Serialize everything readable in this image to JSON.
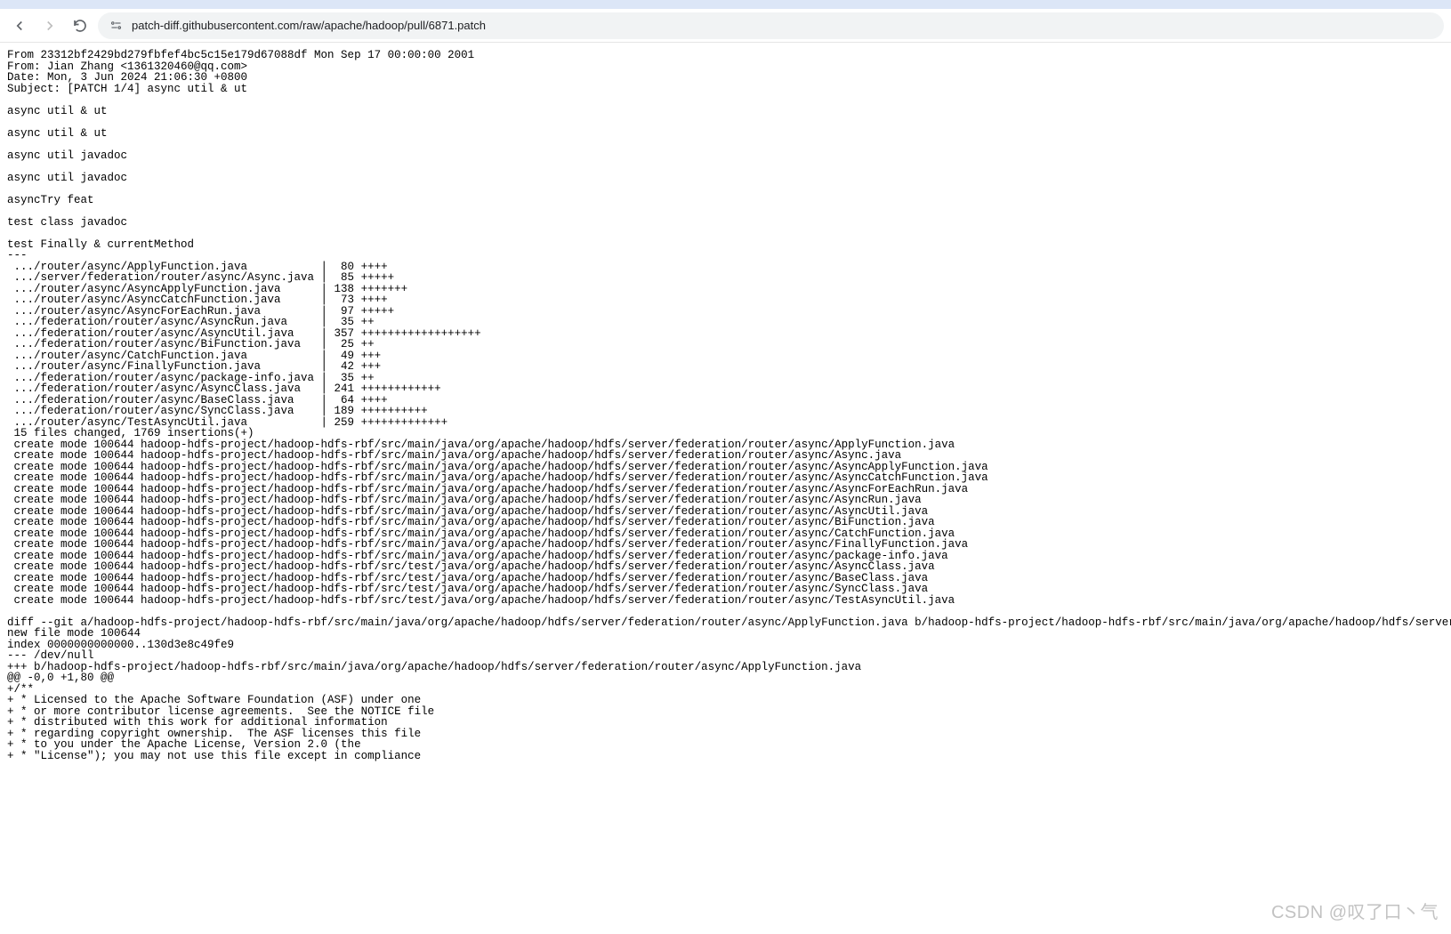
{
  "toolbar": {
    "url": "patch-diff.githubusercontent.com/raw/apache/hadoop/pull/6871.patch"
  },
  "patch": {
    "headers": [
      "From 23312bf2429bd279fbfef4bc5c15e179d67088df Mon Sep 17 00:00:00 2001",
      "From: Jian Zhang <1361320460@qq.com>",
      "Date: Mon, 3 Jun 2024 21:06:30 +0800",
      "Subject: [PATCH 1/4] async util & ut"
    ],
    "body_blocks": [
      "async util & ut",
      "async util & ut",
      "async util javadoc",
      "async util javadoc",
      "asyncTry feat",
      "test class javadoc",
      "test Finally & currentMethod"
    ],
    "sep": "---",
    "diffstat": [
      " .../router/async/ApplyFunction.java           |  80 ++++",
      " .../server/federation/router/async/Async.java |  85 +++++",
      " .../router/async/AsyncApplyFunction.java      | 138 +++++++",
      " .../router/async/AsyncCatchFunction.java      |  73 ++++",
      " .../router/async/AsyncForEachRun.java         |  97 +++++",
      " .../federation/router/async/AsyncRun.java     |  35 ++",
      " .../federation/router/async/AsyncUtil.java    | 357 ++++++++++++++++++",
      " .../federation/router/async/BiFunction.java   |  25 ++",
      " .../router/async/CatchFunction.java           |  49 +++",
      " .../router/async/FinallyFunction.java         |  42 +++",
      " .../federation/router/async/package-info.java |  35 ++",
      " .../federation/router/async/AsyncClass.java   | 241 ++++++++++++",
      " .../federation/router/async/BaseClass.java    |  64 ++++",
      " .../federation/router/async/SyncClass.java    | 189 ++++++++++",
      " .../router/async/TestAsyncUtil.java           | 259 +++++++++++++",
      " 15 files changed, 1769 insertions(+)"
    ],
    "created": [
      " create mode 100644 hadoop-hdfs-project/hadoop-hdfs-rbf/src/main/java/org/apache/hadoop/hdfs/server/federation/router/async/ApplyFunction.java",
      " create mode 100644 hadoop-hdfs-project/hadoop-hdfs-rbf/src/main/java/org/apache/hadoop/hdfs/server/federation/router/async/Async.java",
      " create mode 100644 hadoop-hdfs-project/hadoop-hdfs-rbf/src/main/java/org/apache/hadoop/hdfs/server/federation/router/async/AsyncApplyFunction.java",
      " create mode 100644 hadoop-hdfs-project/hadoop-hdfs-rbf/src/main/java/org/apache/hadoop/hdfs/server/federation/router/async/AsyncCatchFunction.java",
      " create mode 100644 hadoop-hdfs-project/hadoop-hdfs-rbf/src/main/java/org/apache/hadoop/hdfs/server/federation/router/async/AsyncForEachRun.java",
      " create mode 100644 hadoop-hdfs-project/hadoop-hdfs-rbf/src/main/java/org/apache/hadoop/hdfs/server/federation/router/async/AsyncRun.java",
      " create mode 100644 hadoop-hdfs-project/hadoop-hdfs-rbf/src/main/java/org/apache/hadoop/hdfs/server/federation/router/async/AsyncUtil.java",
      " create mode 100644 hadoop-hdfs-project/hadoop-hdfs-rbf/src/main/java/org/apache/hadoop/hdfs/server/federation/router/async/BiFunction.java",
      " create mode 100644 hadoop-hdfs-project/hadoop-hdfs-rbf/src/main/java/org/apache/hadoop/hdfs/server/federation/router/async/CatchFunction.java",
      " create mode 100644 hadoop-hdfs-project/hadoop-hdfs-rbf/src/main/java/org/apache/hadoop/hdfs/server/federation/router/async/FinallyFunction.java",
      " create mode 100644 hadoop-hdfs-project/hadoop-hdfs-rbf/src/main/java/org/apache/hadoop/hdfs/server/federation/router/async/package-info.java",
      " create mode 100644 hadoop-hdfs-project/hadoop-hdfs-rbf/src/test/java/org/apache/hadoop/hdfs/server/federation/router/async/AsyncClass.java",
      " create mode 100644 hadoop-hdfs-project/hadoop-hdfs-rbf/src/test/java/org/apache/hadoop/hdfs/server/federation/router/async/BaseClass.java",
      " create mode 100644 hadoop-hdfs-project/hadoop-hdfs-rbf/src/test/java/org/apache/hadoop/hdfs/server/federation/router/async/SyncClass.java",
      " create mode 100644 hadoop-hdfs-project/hadoop-hdfs-rbf/src/test/java/org/apache/hadoop/hdfs/server/federation/router/async/TestAsyncUtil.java"
    ],
    "diff_body": [
      "diff --git a/hadoop-hdfs-project/hadoop-hdfs-rbf/src/main/java/org/apache/hadoop/hdfs/server/federation/router/async/ApplyFunction.java b/hadoop-hdfs-project/hadoop-hdfs-rbf/src/main/java/org/apache/hadoop/hdfs/server/federation/router/async/ApplyFunction.java",
      "new file mode 100644",
      "index 0000000000000..130d3e8c49fe9",
      "--- /dev/null",
      "+++ b/hadoop-hdfs-project/hadoop-hdfs-rbf/src/main/java/org/apache/hadoop/hdfs/server/federation/router/async/ApplyFunction.java",
      "@@ -0,0 +1,80 @@",
      "+/**",
      "+ * Licensed to the Apache Software Foundation (ASF) under one",
      "+ * or more contributor license agreements.  See the NOTICE file",
      "+ * distributed with this work for additional information",
      "+ * regarding copyright ownership.  The ASF licenses this file",
      "+ * to you under the Apache License, Version 2.0 (the",
      "+ * \"License\"); you may not use this file except in compliance"
    ]
  },
  "watermark": "CSDN @叹了口丶气"
}
